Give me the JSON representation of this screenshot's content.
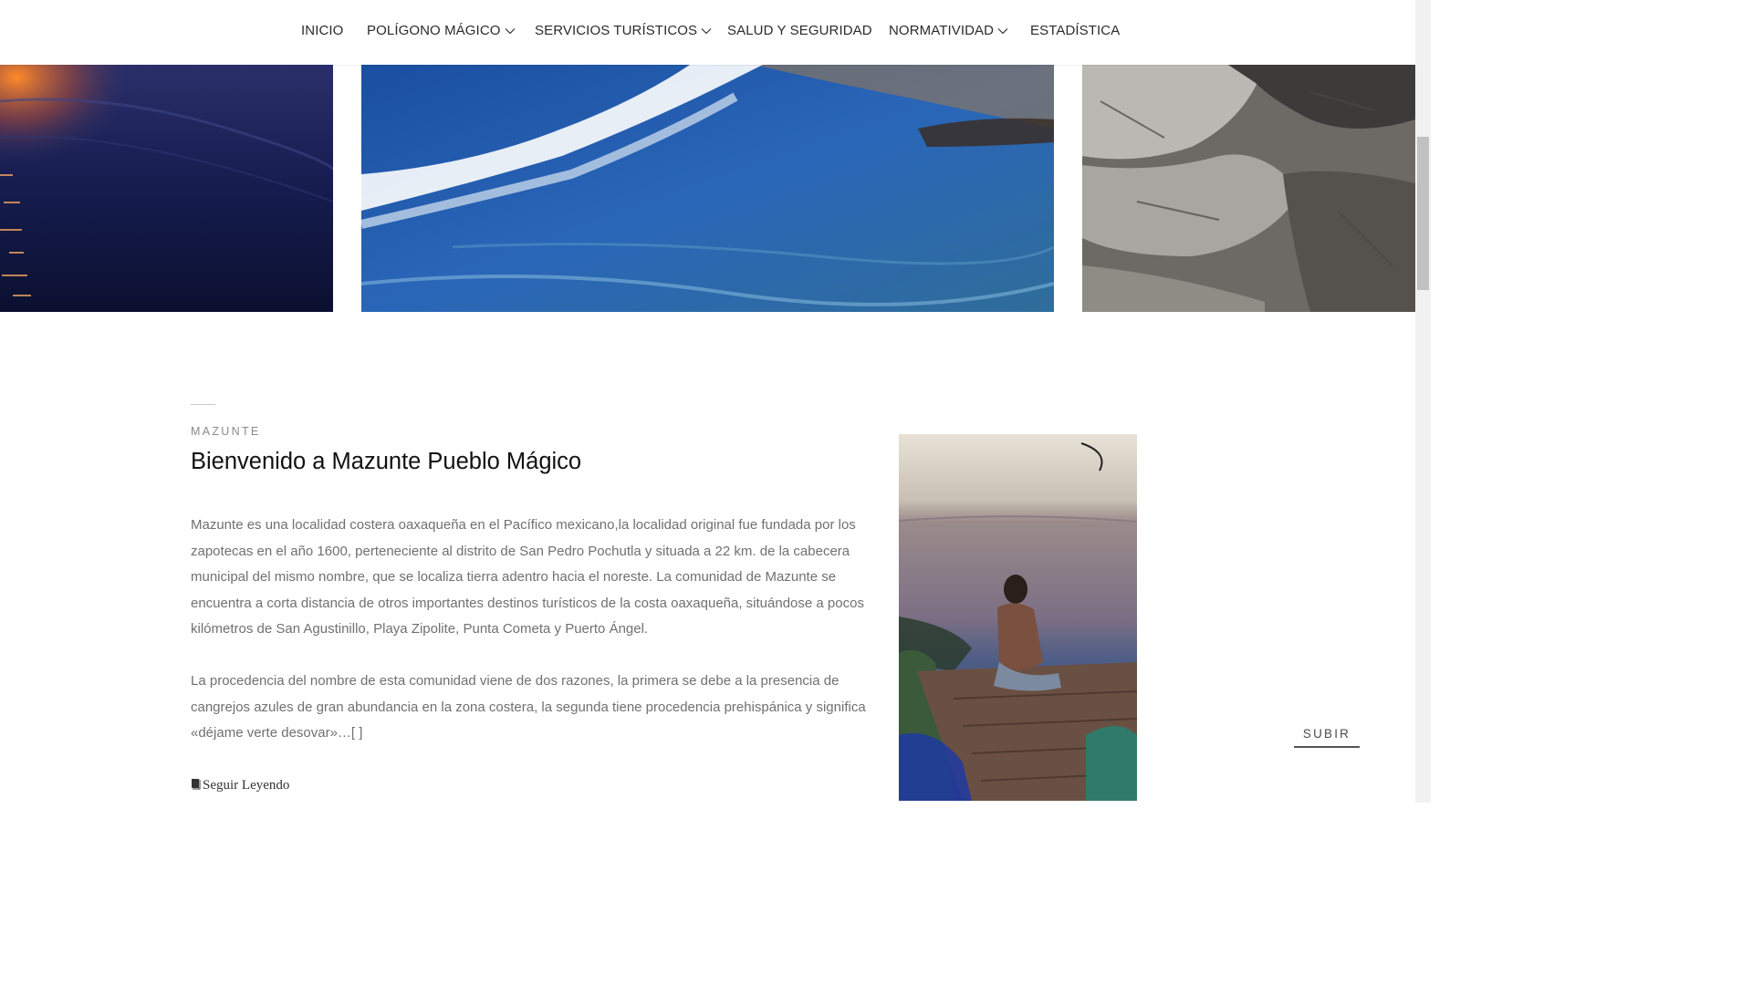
{
  "nav": {
    "items": [
      {
        "label": "INICIO",
        "dropdown": false
      },
      {
        "label": "POLÍGONO MÁGICO",
        "dropdown": true
      },
      {
        "label": "SERVICIOS TURÍSTICOS",
        "dropdown": true
      },
      {
        "label": "SALUD Y SEGURIDAD",
        "dropdown": false
      },
      {
        "label": "NORMATIVIDAD",
        "dropdown": true
      },
      {
        "label": "ESTADÍSTICA",
        "dropdown": false
      }
    ]
  },
  "article": {
    "kicker": "MAZUNTE",
    "title": "Bienvenido a Mazunte Pueblo Mágico",
    "paragraph1": "Mazunte es una localidad costera oaxaqueña en el Pacífico mexicano,la localidad original fue fundada por los zapotecas en el año 1600, perteneciente al distrito de San Pedro Pochutla y situada a 22 km. de la cabecera municipal del mismo nombre, que se localiza tierra adentro hacia el noreste. La comunidad de Mazunte se encuentra a corta distancia de otros importantes destinos turísticos de la costa oaxaqueña, situándose a pocos kilómetros de San Agustinillo, Playa Zipolite, Punta Cometa y Puerto Ángel.",
    "paragraph2": "La procedencia del nombre de esta comunidad viene de dos razones, la primera se debe a la presencia de cangrejos azules de gran abundancia en la zona costera, la segunda tiene procedencia prehispánica y significa «déjame verte desovar»…[ ]",
    "read_more": "Seguir Leyendo"
  },
  "back_to_top": "SUBIR",
  "colors": {
    "accent": "#2b2b2b",
    "body_text": "#707070",
    "title": "#111111"
  },
  "icons": {
    "dropdown": "chevron-down-icon",
    "read_more": "book-icon"
  }
}
